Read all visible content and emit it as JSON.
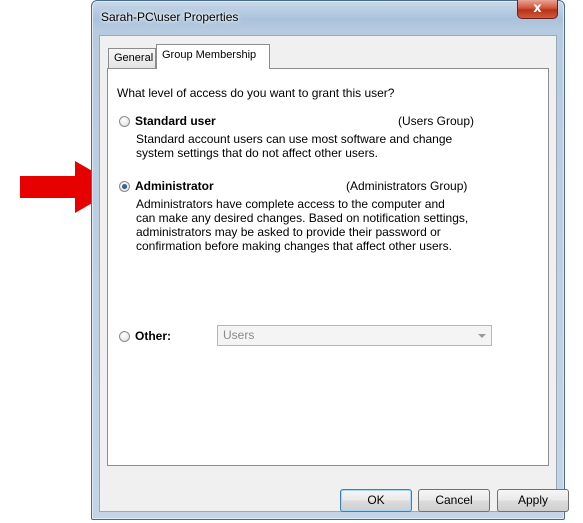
{
  "window": {
    "title": "Sarah-PC\\user Properties",
    "close_glyph": "x"
  },
  "tabs": [
    {
      "label": "General",
      "selected": false
    },
    {
      "label": "Group Membership",
      "selected": true
    }
  ],
  "panel": {
    "question": "What level of access do you want to grant this user?",
    "options": [
      {
        "label": "Standard user",
        "group": "(Users Group)",
        "selected": false,
        "description": [
          "Standard account users can use most software and change",
          "system settings that do not affect other users."
        ]
      },
      {
        "label": "Administrator",
        "group": "(Administrators Group)",
        "selected": true,
        "description": [
          "Administrators have complete access to the computer and",
          "can make any desired changes. Based on notification settings,",
          "administrators may be asked to provide their password or",
          "confirmation before making changes that affect other users."
        ]
      },
      {
        "label": "Other:",
        "selected": false,
        "select_value": "Users"
      }
    ]
  },
  "buttons": {
    "ok": "OK",
    "cancel": "Cancel",
    "apply": "Apply"
  },
  "colors": {
    "annotation_arrow": "#e60000",
    "close_button": "#c8452a"
  },
  "icons": [
    "close-icon",
    "radio-icon",
    "dropdown-arrow-icon",
    "red-arrow-annotation"
  ]
}
